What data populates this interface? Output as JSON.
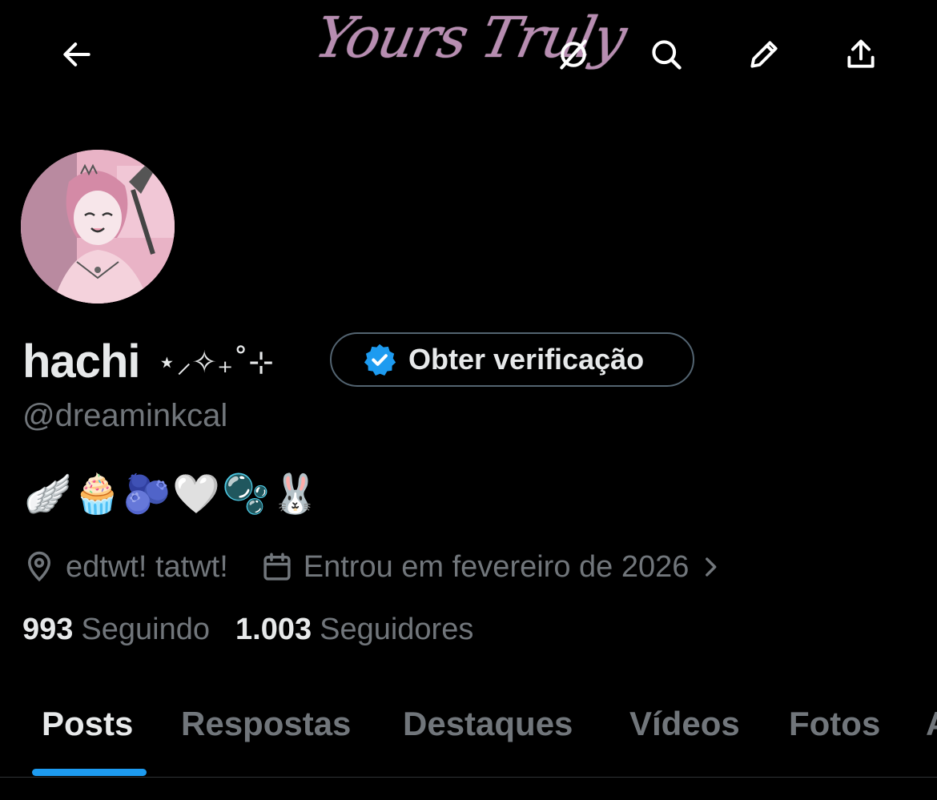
{
  "header": {
    "banner_text": "Yours Truly",
    "back_label": "back",
    "icons": [
      "arrow-left-icon",
      "grok-icon",
      "search-icon",
      "edit-pencil-icon",
      "share-icon"
    ]
  },
  "profile": {
    "name": "hachi",
    "name_decoration": "⋆⸝✧₊˚⊹",
    "verify_button_label": "Obter verificação",
    "handle": "@dreaminkcal",
    "bio": "🪽🧁🫐🤍🫧🐰",
    "location": "edtwt! tatwt!",
    "joined": "Entrou em fevereiro de 2026"
  },
  "stats": {
    "following_count": "993",
    "following_label": "Seguindo",
    "followers_count": "1.003",
    "followers_label": "Seguidores"
  },
  "tabs": [
    {
      "label": "Posts",
      "active": true
    },
    {
      "label": "Respostas",
      "active": false
    },
    {
      "label": "Destaques",
      "active": false
    },
    {
      "label": "Vídeos",
      "active": false
    },
    {
      "label": "Fotos",
      "active": false
    },
    {
      "label": "A",
      "active": false
    }
  ],
  "colors": {
    "accent": "#1d9bf0",
    "verified_badge": "#1d9bf0",
    "text_primary": "#e7e9ea",
    "text_secondary": "#71767b",
    "banner_pink": "#c79ac0"
  }
}
